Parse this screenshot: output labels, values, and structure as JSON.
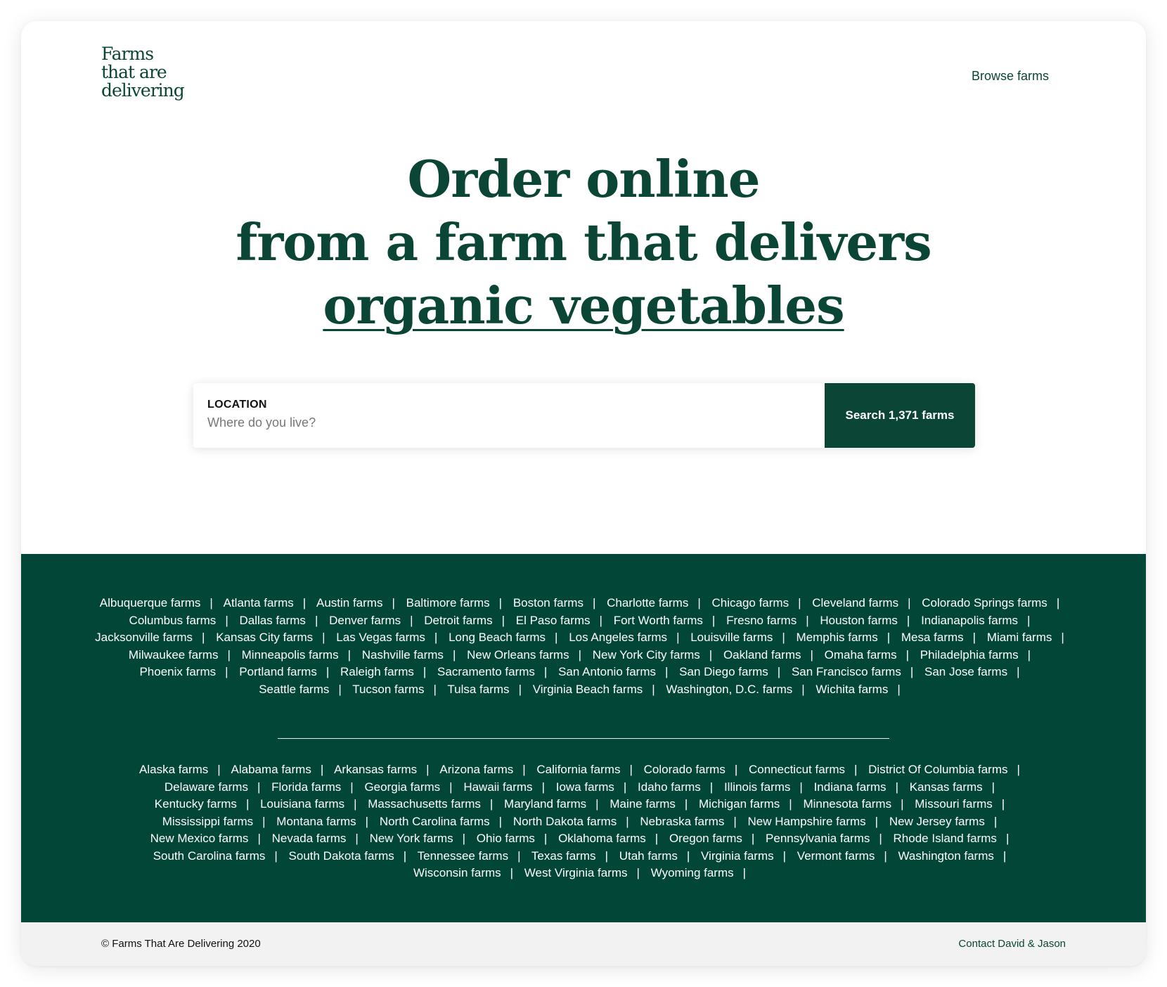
{
  "header": {
    "logo": [
      "Farms",
      "that are",
      "delivering"
    ],
    "nav_link": "Browse farms"
  },
  "hero": {
    "line1": "Order online",
    "line2": "from a farm that delivers",
    "highlight": "organic vegetables"
  },
  "search": {
    "label": "LOCATION",
    "placeholder": "Where do you live?",
    "value": "",
    "button_label": "Search 1,371 farms"
  },
  "city_links": [
    "Albuquerque farms",
    "Atlanta farms",
    "Austin farms",
    "Baltimore farms",
    "Boston farms",
    "Charlotte farms",
    "Chicago farms",
    "Cleveland farms",
    "Colorado Springs farms",
    "Columbus farms",
    "Dallas farms",
    "Denver farms",
    "Detroit farms",
    "El Paso farms",
    "Fort Worth farms",
    "Fresno farms",
    "Houston farms",
    "Indianapolis farms",
    "Jacksonville farms",
    "Kansas City farms",
    "Las Vegas farms",
    "Long Beach farms",
    "Los Angeles farms",
    "Louisville farms",
    "Memphis farms",
    "Mesa farms",
    "Miami farms",
    "Milwaukee farms",
    "Minneapolis farms",
    "Nashville farms",
    "New Orleans farms",
    "New York City farms",
    "Oakland farms",
    "Omaha farms",
    "Philadelphia farms",
    "Phoenix farms",
    "Portland farms",
    "Raleigh farms",
    "Sacramento farms",
    "San Antonio farms",
    "San Diego farms",
    "San Francisco farms",
    "San Jose farms",
    "Seattle farms",
    "Tucson farms",
    "Tulsa farms",
    "Virginia Beach farms",
    "Washington, D.C. farms",
    "Wichita farms"
  ],
  "state_links": [
    "Alaska farms",
    "Alabama farms",
    "Arkansas farms",
    "Arizona farms",
    "California farms",
    "Colorado farms",
    "Connecticut farms",
    "District Of Columbia farms",
    "Delaware farms",
    "Florida farms",
    "Georgia farms",
    "Hawaii farms",
    "Iowa farms",
    "Idaho farms",
    "Illinois farms",
    "Indiana farms",
    "Kansas farms",
    "Kentucky farms",
    "Louisiana farms",
    "Massachusetts farms",
    "Maryland farms",
    "Maine farms",
    "Michigan farms",
    "Minnesota farms",
    "Missouri farms",
    "Mississippi farms",
    "Montana farms",
    "North Carolina farms",
    "North Dakota farms",
    "Nebraska farms",
    "New Hampshire farms",
    "New Jersey farms",
    "New Mexico farms",
    "Nevada farms",
    "New York farms",
    "Ohio farms",
    "Oklahoma farms",
    "Oregon farms",
    "Pennsylvania farms",
    "Rhode Island farms",
    "South Carolina farms",
    "South Dakota farms",
    "Tennessee farms",
    "Texas farms",
    "Utah farms",
    "Virginia farms",
    "Vermont farms",
    "Washington farms",
    "Wisconsin farms",
    "West Virginia farms",
    "Wyoming farms"
  ],
  "link_separator": "|",
  "footer": {
    "copyright": "© Farms That Are Delivering 2020",
    "contact": "Contact David & Jason"
  },
  "colors": {
    "brand_green": "#0b4535",
    "section_green": "#024638",
    "footer_bg": "#f2f2f2"
  }
}
